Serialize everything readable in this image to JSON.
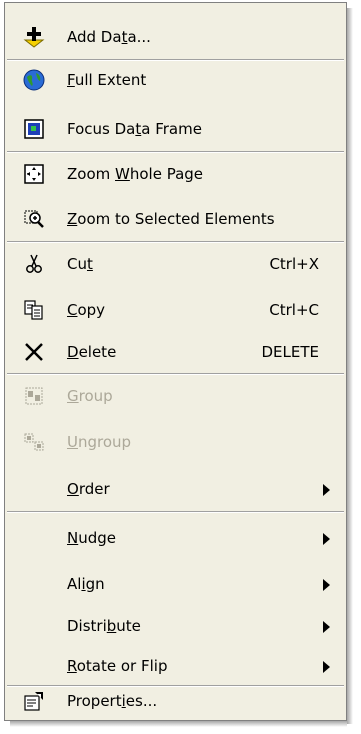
{
  "menu": {
    "add_data": {
      "prefix": "Add Da",
      "accel": "t",
      "suffix": "a...",
      "icon": "add-data-icon"
    },
    "full_extent": {
      "prefix": "",
      "accel": "F",
      "suffix": "ull Extent",
      "icon": "globe-icon"
    },
    "focus_data_frame": {
      "prefix": "Focus Da",
      "accel": "t",
      "suffix": "a Frame",
      "icon": "data-frame-icon"
    },
    "zoom_whole_page": {
      "prefix": "Zoom ",
      "accel": "W",
      "suffix": "hole Page",
      "icon": "zoom-whole-page-icon"
    },
    "zoom_selected": {
      "prefix": "",
      "accel": "Z",
      "suffix": "oom to Selected Elements",
      "icon": "zoom-selected-icon"
    },
    "cut": {
      "prefix": "Cu",
      "accel": "t",
      "suffix": "",
      "shortcut": "Ctrl+X",
      "icon": "scissors-icon"
    },
    "copy": {
      "prefix": "",
      "accel": "C",
      "suffix": "opy",
      "shortcut": "Ctrl+C",
      "icon": "copy-icon"
    },
    "delete": {
      "prefix": "",
      "accel": "D",
      "suffix": "elete",
      "shortcut": "DELETE",
      "icon": "delete-x-icon"
    },
    "group": {
      "prefix": "",
      "accel": "G",
      "suffix": "roup",
      "icon": "group-icon",
      "disabled": true
    },
    "ungroup": {
      "prefix": "",
      "accel": "U",
      "suffix": "ngroup",
      "icon": "ungroup-icon",
      "disabled": true
    },
    "order": {
      "prefix": "",
      "accel": "O",
      "suffix": "rder"
    },
    "nudge": {
      "prefix": "",
      "accel": "N",
      "suffix": "udge"
    },
    "align": {
      "prefix": "Al",
      "accel": "i",
      "suffix": "gn"
    },
    "distribute": {
      "prefix": "Distri",
      "accel": "b",
      "suffix": "ute"
    },
    "rotate_flip": {
      "prefix": "",
      "accel": "R",
      "suffix": "otate or Flip"
    },
    "properties": {
      "prefix": "Propert",
      "accel": "i",
      "suffix": "es...",
      "icon": "properties-icon"
    }
  },
  "colors": {
    "menu_bg": "#f1efe2",
    "disabled_text": "#aca899",
    "separator": "#a0a0a0"
  }
}
